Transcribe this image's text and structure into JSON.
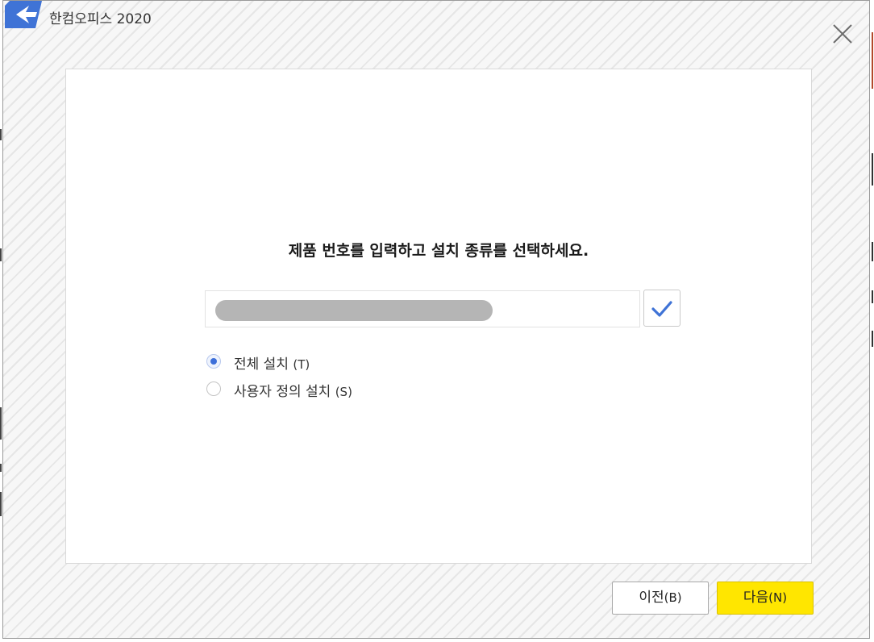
{
  "window": {
    "title": "한컴오피스 2020"
  },
  "main": {
    "heading": "제품 번호를 입력하고 설치 종류를 선택하세요.",
    "serial": {
      "value_visible": false
    },
    "install_options": [
      {
        "label": "전체 설치",
        "mnemonic": "(T)",
        "selected": true
      },
      {
        "label": "사용자 정의 설치",
        "mnemonic": "(S)",
        "selected": false
      }
    ]
  },
  "footer": {
    "prev": {
      "label": "이전",
      "mnemonic": "(B)"
    },
    "next": {
      "label": "다음",
      "mnemonic": "(N)"
    }
  },
  "icons": {
    "logo": "hancom-logo-icon",
    "close": "close-icon",
    "check": "checkmark-icon"
  },
  "colors": {
    "accent_blue": "#3d6fd9",
    "next_button": "#ffe600",
    "check_icon": "#3f73d6"
  }
}
